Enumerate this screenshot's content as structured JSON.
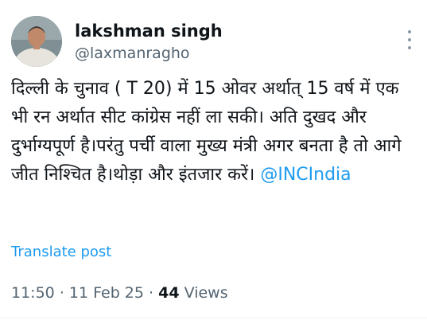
{
  "author": {
    "display_name": "lakshman singh",
    "handle": "@laxmanragho"
  },
  "icons": {
    "more": "more-options-icon",
    "avatar": "user-avatar"
  },
  "tweet": {
    "text": "दिल्ली के चुनाव ( T 20) में 15 ओवर अर्थात् 15 वर्ष में एक भी रन अर्थात सीट कांग्रेस नहीं ला सकी। अति दुखद और दुर्भाग्यपूर्ण है।परंतु पर्ची वाला मुख्य मंत्री अगर बनता है तो आगे जीत निश्चित है।थोड़ा और इंतजार करें। ",
    "mention": "@INCIndia"
  },
  "translate_label": "Translate post",
  "meta": {
    "time": "11:50",
    "date": "11 Feb 25",
    "separator": "·",
    "views_count": "44",
    "views_label": "Views"
  },
  "colors": {
    "accent": "#1d9bf0",
    "secondary_text": "#536471",
    "primary_text": "#0f1419"
  }
}
